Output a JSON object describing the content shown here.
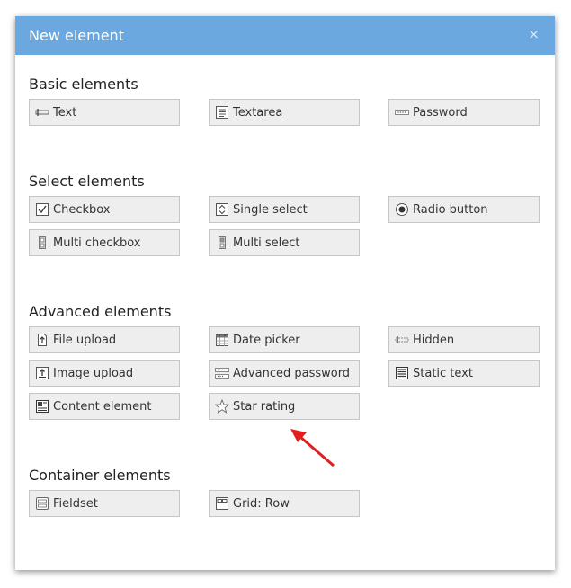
{
  "dialog": {
    "title": "New element",
    "close_glyph": "×"
  },
  "sections": {
    "basic": {
      "title": "Basic elements",
      "text": {
        "label": "Text",
        "icon": "text-field-icon"
      },
      "textarea": {
        "label": "Textarea",
        "icon": "textarea-icon"
      },
      "password": {
        "label": "Password",
        "icon": "password-icon"
      }
    },
    "select": {
      "title": "Select elements",
      "checkbox": {
        "label": "Checkbox",
        "icon": "checkbox-icon"
      },
      "single_select": {
        "label": "Single select",
        "icon": "single-select-icon"
      },
      "radio": {
        "label": "Radio button",
        "icon": "radio-button-icon"
      },
      "multi_checkbox": {
        "label": "Multi checkbox",
        "icon": "multi-checkbox-icon"
      },
      "multi_select": {
        "label": "Multi select",
        "icon": "multi-select-icon"
      }
    },
    "advanced": {
      "title": "Advanced elements",
      "file_upload": {
        "label": "File upload",
        "icon": "file-upload-icon"
      },
      "date_picker": {
        "label": "Date picker",
        "icon": "calendar-icon"
      },
      "hidden": {
        "label": "Hidden",
        "icon": "hidden-field-icon"
      },
      "image_upload": {
        "label": "Image upload",
        "icon": "image-upload-icon"
      },
      "advanced_password": {
        "label": "Advanced password",
        "icon": "advanced-password-icon"
      },
      "static_text": {
        "label": "Static text",
        "icon": "static-text-icon"
      },
      "content_element": {
        "label": "Content element",
        "icon": "content-element-icon"
      },
      "star_rating": {
        "label": "Star rating",
        "icon": "star-icon"
      }
    },
    "container": {
      "title": "Container elements",
      "fieldset": {
        "label": "Fieldset",
        "icon": "fieldset-icon"
      },
      "grid_row": {
        "label": "Grid: Row",
        "icon": "grid-row-icon"
      }
    }
  },
  "annotation": {
    "arrow_color": "#e02020"
  }
}
